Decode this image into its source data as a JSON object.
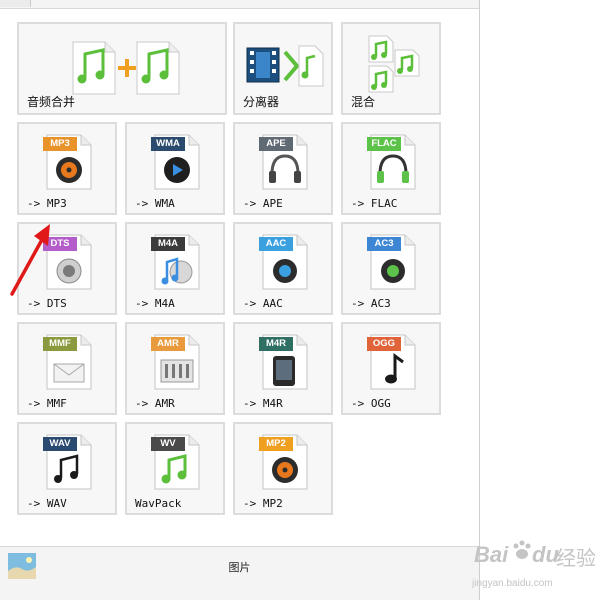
{
  "tiles": {
    "merge": {
      "label": "音频合并"
    },
    "split": {
      "label": "分离器"
    },
    "mix": {
      "label": "混合"
    },
    "mp3": {
      "badge": "MP3",
      "label": "-> MP3",
      "badge_color": "#e8922a"
    },
    "wma": {
      "badge": "WMA",
      "label": "-> WMA",
      "badge_color": "#2a4a6e"
    },
    "ape": {
      "badge": "APE",
      "label": "-> APE",
      "badge_color": "#606a74"
    },
    "flac": {
      "badge": "FLAC",
      "label": "-> FLAC",
      "badge_color": "#5cc24a"
    },
    "dts": {
      "badge": "DTS",
      "label": "-> DTS",
      "badge_color": "#b45cc9"
    },
    "m4a": {
      "badge": "M4A",
      "label": "-> M4A",
      "badge_color": "#3b3b3b"
    },
    "aac": {
      "badge": "AAC",
      "label": "-> AAC",
      "badge_color": "#3aa0e0"
    },
    "ac3": {
      "badge": "AC3",
      "label": "-> AC3",
      "badge_color": "#3c86d4"
    },
    "mmf": {
      "badge": "MMF",
      "label": "-> MMF",
      "badge_color": "#8c9a3e"
    },
    "amr": {
      "badge": "AMR",
      "label": "-> AMR",
      "badge_color": "#e89a3c"
    },
    "m4r": {
      "badge": "M4R",
      "label": "-> M4R",
      "badge_color": "#2f6f64"
    },
    "ogg": {
      "badge": "OGG",
      "label": "-> OGG",
      "badge_color": "#e0633a"
    },
    "wav": {
      "badge": "WAV",
      "label": "-> WAV",
      "badge_color": "#2b4a70"
    },
    "wv": {
      "badge": "WV",
      "label": "WavPack",
      "badge_color": "#4a4a4a"
    },
    "mp2": {
      "badge": "MP2",
      "label": "-> MP2",
      "badge_color": "#f0a020"
    }
  },
  "bottom": {
    "picture_label": "图片"
  },
  "watermark": {
    "brand": "Bai",
    "du": "du",
    "jingyan": "经验",
    "url": "jingyan.baidu.com"
  },
  "colors": {
    "tile_bg": "#f7f7f7",
    "tile_border": "#dcdcdc",
    "arrow": "#e01818",
    "note_green": "#5bbf3a"
  }
}
